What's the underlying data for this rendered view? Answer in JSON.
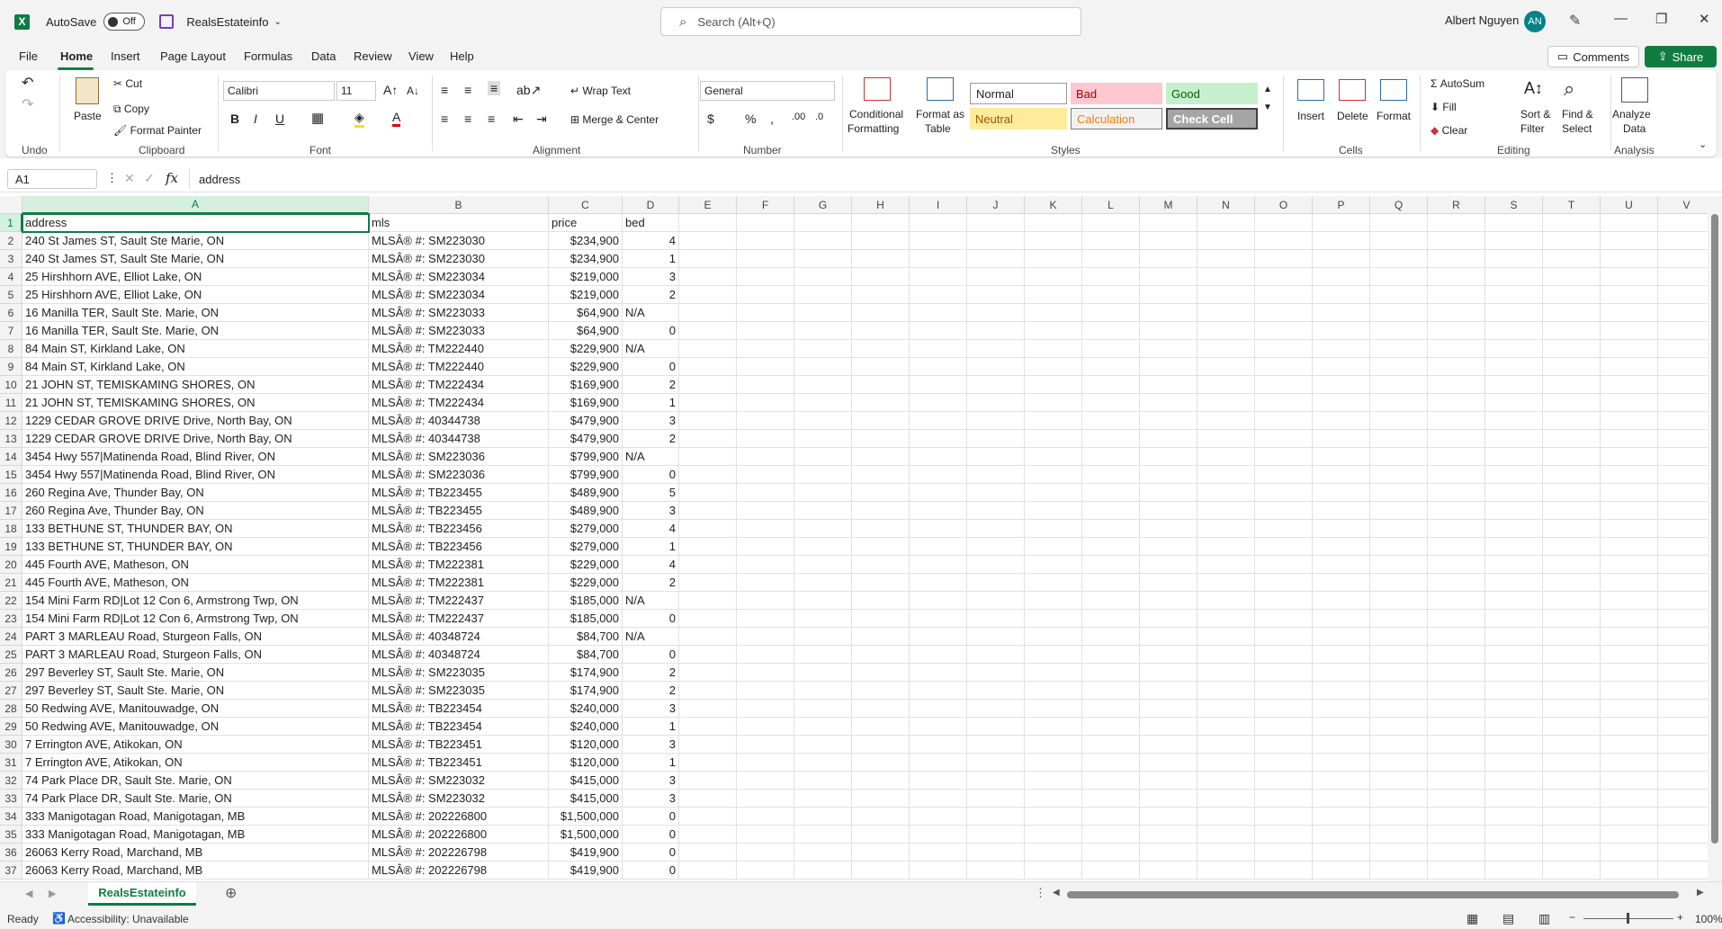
{
  "app": {
    "autosave_label": "AutoSave",
    "autosave_state": "Off",
    "doc_name": "RealsEstateinfo",
    "search_placeholder": "Search (Alt+Q)",
    "user_name": "Albert Nguyen",
    "user_initials": "AN"
  },
  "menu": [
    "File",
    "Home",
    "Insert",
    "Page Layout",
    "Formulas",
    "Data",
    "Review",
    "View",
    "Help"
  ],
  "menu_right": {
    "comments": "Comments",
    "share": "Share"
  },
  "ribbon": {
    "undo_group": "Undo",
    "clipboard": {
      "paste": "Paste",
      "cut": "Cut",
      "copy": "Copy",
      "format_painter": "Format Painter",
      "label": "Clipboard"
    },
    "font": {
      "name": "Calibri",
      "size": "11",
      "label": "Font"
    },
    "alignment": {
      "wrap": "Wrap Text",
      "merge": "Merge & Center",
      "label": "Alignment"
    },
    "number": {
      "format": "General",
      "label": "Number"
    },
    "styles": {
      "conditional_line1": "Conditional",
      "conditional_line2": "Formatting",
      "format_table_line1": "Format as",
      "format_table_line2": "Table",
      "normal": "Normal",
      "bad": "Bad",
      "good": "Good",
      "neutral": "Neutral",
      "calculation": "Calculation",
      "check_cell": "Check Cell",
      "label": "Styles"
    },
    "cells": {
      "insert": "Insert",
      "delete": "Delete",
      "format": "Format",
      "label": "Cells"
    },
    "editing": {
      "autosum": "AutoSum",
      "fill": "Fill",
      "clear": "Clear",
      "sort_line1": "Sort &",
      "sort_line2": "Filter",
      "find_line1": "Find &",
      "find_line2": "Select",
      "label": "Editing"
    },
    "analysis": {
      "analyze_line1": "Analyze",
      "analyze_line2": "Data",
      "label": "Analysis"
    }
  },
  "formula_bar": {
    "name_box": "A1",
    "fx": "fx",
    "value": "address"
  },
  "columns": [
    "A",
    "B",
    "C",
    "D",
    "E",
    "F",
    "G",
    "H",
    "I",
    "J",
    "K",
    "L",
    "M",
    "N",
    "O",
    "P",
    "Q",
    "R",
    "S",
    "T",
    "U",
    "V"
  ],
  "header_row": [
    "address",
    "mls",
    "price",
    "bed"
  ],
  "rows": [
    [
      "240 St James ST, Sault Ste Marie, ON",
      "MLSÂ® #: SM223030",
      "$234,900",
      "4"
    ],
    [
      "240 St James ST, Sault Ste Marie, ON",
      "MLSÂ® #: SM223030",
      "$234,900",
      "1"
    ],
    [
      "25 Hirshhorn AVE, Elliot Lake, ON",
      "MLSÂ® #: SM223034",
      "$219,000",
      "3"
    ],
    [
      "25 Hirshhorn AVE, Elliot Lake, ON",
      "MLSÂ® #: SM223034",
      "$219,000",
      "2"
    ],
    [
      "16 Manilla TER, Sault Ste. Marie, ON",
      "MLSÂ® #: SM223033",
      "$64,900",
      "N/A"
    ],
    [
      "16 Manilla TER, Sault Ste. Marie, ON",
      "MLSÂ® #: SM223033",
      "$64,900",
      "0"
    ],
    [
      "84 Main ST, Kirkland Lake, ON",
      "MLSÂ® #: TM222440",
      "$229,900",
      "N/A"
    ],
    [
      "84 Main ST, Kirkland Lake, ON",
      "MLSÂ® #: TM222440",
      "$229,900",
      "0"
    ],
    [
      "21 JOHN ST, TEMISKAMING SHORES, ON",
      "MLSÂ® #: TM222434",
      "$169,900",
      "2"
    ],
    [
      "21 JOHN ST, TEMISKAMING SHORES, ON",
      "MLSÂ® #: TM222434",
      "$169,900",
      "1"
    ],
    [
      "1229 CEDAR GROVE DRIVE Drive, North Bay, ON",
      "MLSÂ® #: 40344738",
      "$479,900",
      "3"
    ],
    [
      "1229 CEDAR GROVE DRIVE Drive, North Bay, ON",
      "MLSÂ® #: 40344738",
      "$479,900",
      "2"
    ],
    [
      "3454 Hwy 557|Matinenda Road, Blind River, ON",
      "MLSÂ® #: SM223036",
      "$799,900",
      "N/A"
    ],
    [
      "3454 Hwy 557|Matinenda Road, Blind River, ON",
      "MLSÂ® #: SM223036",
      "$799,900",
      "0"
    ],
    [
      "260 Regina Ave, Thunder Bay, ON",
      "MLSÂ® #: TB223455",
      "$489,900",
      "5"
    ],
    [
      "260 Regina Ave, Thunder Bay, ON",
      "MLSÂ® #: TB223455",
      "$489,900",
      "3"
    ],
    [
      "133 BETHUNE ST, THUNDER BAY, ON",
      "MLSÂ® #: TB223456",
      "$279,000",
      "4"
    ],
    [
      "133 BETHUNE ST, THUNDER BAY, ON",
      "MLSÂ® #: TB223456",
      "$279,000",
      "1"
    ],
    [
      "445 Fourth AVE, Matheson, ON",
      "MLSÂ® #: TM222381",
      "$229,000",
      "4"
    ],
    [
      "445 Fourth AVE, Matheson, ON",
      "MLSÂ® #: TM222381",
      "$229,000",
      "2"
    ],
    [
      "154 Mini Farm RD|Lot 12  Con 6, Armstrong Twp, ON",
      "MLSÂ® #: TM222437",
      "$185,000",
      "N/A"
    ],
    [
      "154 Mini Farm RD|Lot 12  Con 6, Armstrong Twp, ON",
      "MLSÂ® #: TM222437",
      "$185,000",
      "0"
    ],
    [
      "PART 3 MARLEAU Road, Sturgeon Falls, ON",
      "MLSÂ® #: 40348724",
      "$84,700",
      "N/A"
    ],
    [
      "PART 3 MARLEAU Road, Sturgeon Falls, ON",
      "MLSÂ® #: 40348724",
      "$84,700",
      "0"
    ],
    [
      "297 Beverley ST, Sault Ste. Marie, ON",
      "MLSÂ® #: SM223035",
      "$174,900",
      "2"
    ],
    [
      "297 Beverley ST, Sault Ste. Marie, ON",
      "MLSÂ® #: SM223035",
      "$174,900",
      "2"
    ],
    [
      "50 Redwing AVE, Manitouwadge, ON",
      "MLSÂ® #: TB223454",
      "$240,000",
      "3"
    ],
    [
      "50 Redwing AVE, Manitouwadge, ON",
      "MLSÂ® #: TB223454",
      "$240,000",
      "1"
    ],
    [
      "7 Errington AVE, Atikokan, ON",
      "MLSÂ® #: TB223451",
      "$120,000",
      "3"
    ],
    [
      "7 Errington AVE, Atikokan, ON",
      "MLSÂ® #: TB223451",
      "$120,000",
      "1"
    ],
    [
      "74 Park Place DR, Sault Ste. Marie, ON",
      "MLSÂ® #: SM223032",
      "$415,000",
      "3"
    ],
    [
      "74 Park Place DR, Sault Ste. Marie, ON",
      "MLSÂ® #: SM223032",
      "$415,000",
      "3"
    ],
    [
      "333 Manigotagan Road, Manigotagan, MB",
      "MLSÂ® #: 202226800",
      "$1,500,000",
      "0"
    ],
    [
      "333 Manigotagan Road, Manigotagan, MB",
      "MLSÂ® #: 202226800",
      "$1,500,000",
      "0"
    ],
    [
      "26063 Kerry Road, Marchand, MB",
      "MLSÂ® #: 202226798",
      "$419,900",
      "0"
    ],
    [
      "26063 Kerry Road, Marchand, MB",
      "MLSÂ® #: 202226798",
      "$419,900",
      "0"
    ]
  ],
  "sheet_tab": "RealsEstateinfo",
  "status": {
    "ready": "Ready",
    "accessibility": "Accessibility: Unavailable",
    "zoom": "100%"
  }
}
